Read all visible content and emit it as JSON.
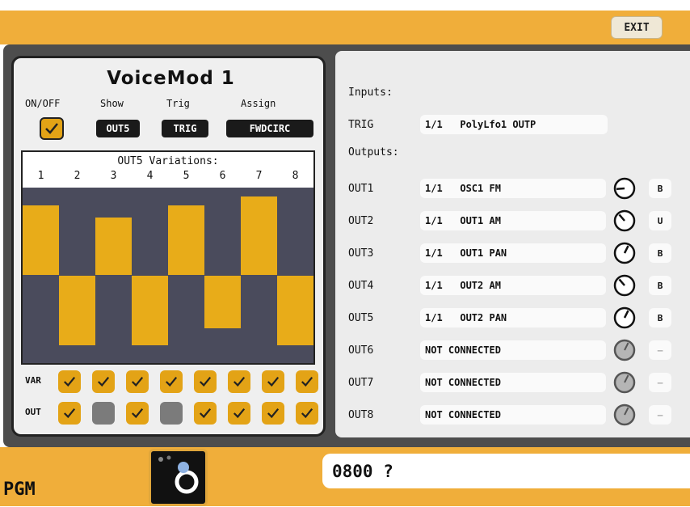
{
  "topbar": {
    "exit_label": "EXIT"
  },
  "module": {
    "title": "VoiceMod 1",
    "onoff_label": "ON/OFF",
    "show_label": "Show",
    "trig_label": "Trig",
    "assign_label": "Assign",
    "onoff_checked": true,
    "show_value": "OUT5",
    "trig_value": "TRIG",
    "assign_value": "FWDCIRC"
  },
  "variations": {
    "title": "OUT5 Variations:",
    "numbers": [
      "1",
      "2",
      "3",
      "4",
      "5",
      "6",
      "7",
      "8"
    ],
    "levels": [
      0.4,
      -0.4,
      0.33,
      -0.4,
      0.4,
      -0.3,
      0.45,
      -0.4
    ],
    "var_label": "VAR",
    "out_label": "OUT",
    "var_states": [
      true,
      true,
      true,
      true,
      true,
      true,
      true,
      true
    ],
    "out_states": [
      true,
      false,
      true,
      false,
      true,
      true,
      true,
      true
    ]
  },
  "routing": {
    "inputs_label": "Inputs:",
    "outputs_label": "Outputs:",
    "trig": {
      "name": "TRIG",
      "value": "1/1   PolyLfo1 OUTP"
    },
    "outputs": [
      {
        "name": "OUT1",
        "value": "1/1   OSC1 FM",
        "mode": "B",
        "knob": 0.15,
        "connected": true
      },
      {
        "name": "OUT2",
        "value": "1/1   OUT1 AM",
        "mode": "U",
        "knob": 0.35,
        "connected": true
      },
      {
        "name": "OUT3",
        "value": "1/1   OUT1 PAN",
        "mode": "B",
        "knob": 0.6,
        "connected": true
      },
      {
        "name": "OUT4",
        "value": "1/1   OUT2 AM",
        "mode": "B",
        "knob": 0.35,
        "connected": true
      },
      {
        "name": "OUT5",
        "value": "1/1   OUT2 PAN",
        "mode": "B",
        "knob": 0.6,
        "connected": true
      },
      {
        "name": "OUT6",
        "value": "NOT CONNECTED",
        "mode": "–",
        "knob": 0.6,
        "connected": false
      },
      {
        "name": "OUT7",
        "value": "NOT CONNECTED",
        "mode": "–",
        "knob": 0.6,
        "connected": false
      },
      {
        "name": "OUT8",
        "value": "NOT CONNECTED",
        "mode": "–",
        "knob": 0.6,
        "connected": false
      }
    ]
  },
  "bottom": {
    "pgm_label": "PGM",
    "display_value": "0800 ?"
  },
  "colors": {
    "accent": "#f0ae3a",
    "bar": "#e8ac19",
    "wave_bg": "#4a4b5c"
  },
  "icons": {
    "exit": "exit-button",
    "check": "check-icon",
    "knob": "knob-icon",
    "program": "program-dial-icon"
  }
}
